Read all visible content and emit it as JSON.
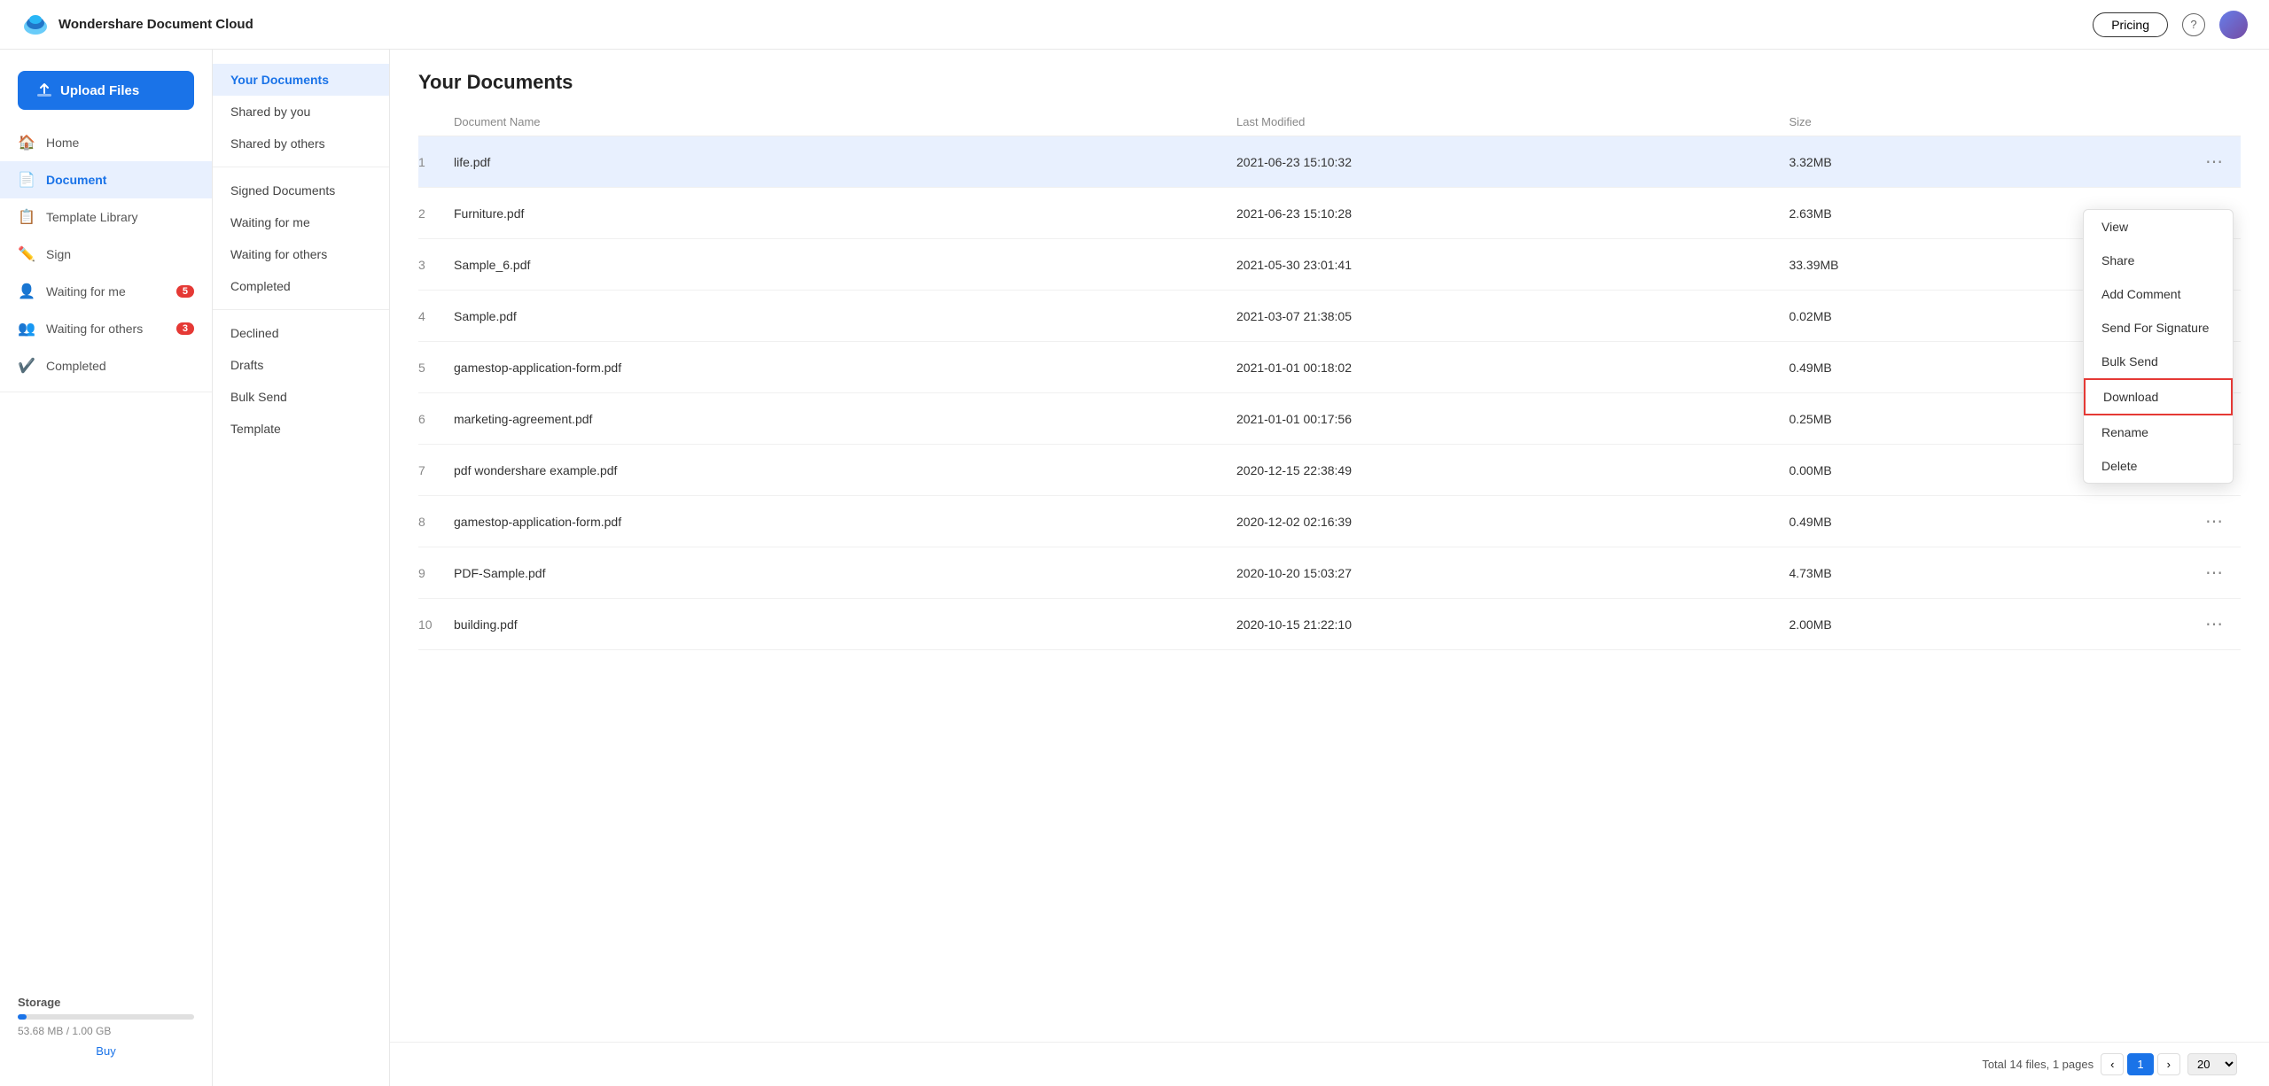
{
  "topbar": {
    "app_title": "Wondershare Document Cloud",
    "pricing_label": "Pricing",
    "help_symbol": "?",
    "logo_colors": [
      "#29b6f6",
      "#1565c0"
    ]
  },
  "sidebar": {
    "upload_label": "Upload Files",
    "nav_items": [
      {
        "id": "home",
        "label": "Home",
        "icon": "home"
      },
      {
        "id": "document",
        "label": "Document",
        "icon": "document",
        "active": true
      },
      {
        "id": "template-library",
        "label": "Template Library",
        "icon": "template"
      },
      {
        "id": "sign",
        "label": "Sign",
        "icon": "sign"
      },
      {
        "id": "waiting-for-me",
        "label": "Waiting for me",
        "icon": "person",
        "badge": "5"
      },
      {
        "id": "waiting-for-others",
        "label": "Waiting for others",
        "icon": "group",
        "badge": "3"
      },
      {
        "id": "completed",
        "label": "Completed",
        "icon": "check"
      }
    ],
    "storage_label": "Storage",
    "storage_used": "53.68 MB / 1.00 GB",
    "storage_percent": 5.3,
    "buy_label": "Buy"
  },
  "center_panel": {
    "nav_items": [
      {
        "id": "your-documents",
        "label": "Your Documents",
        "active": true
      },
      {
        "id": "shared-by-you",
        "label": "Shared by you"
      },
      {
        "id": "shared-by-others",
        "label": "Shared by others"
      },
      {
        "id": "signed-documents",
        "label": "Signed Documents"
      },
      {
        "id": "waiting-for-me",
        "label": "Waiting for me"
      },
      {
        "id": "waiting-for-others",
        "label": "Waiting for others"
      },
      {
        "id": "completed",
        "label": "Completed"
      },
      {
        "id": "declined",
        "label": "Declined"
      },
      {
        "id": "drafts",
        "label": "Drafts"
      },
      {
        "id": "bulk-send",
        "label": "Bulk Send"
      },
      {
        "id": "template",
        "label": "Template"
      }
    ]
  },
  "main": {
    "title": "Your Documents",
    "columns": [
      "",
      "Document Name",
      "Last Modified",
      "Size",
      ""
    ],
    "rows": [
      {
        "num": 1,
        "name": "life.pdf",
        "modified": "2021-06-23 15:10:32",
        "size": "3.32MB",
        "highlighted": true
      },
      {
        "num": 2,
        "name": "Furniture.pdf",
        "modified": "2021-06-23 15:10:28",
        "size": "2.63MB",
        "highlighted": false
      },
      {
        "num": 3,
        "name": "Sample_6.pdf",
        "modified": "2021-05-30 23:01:41",
        "size": "33.39MB",
        "highlighted": false
      },
      {
        "num": 4,
        "name": "Sample.pdf",
        "modified": "2021-03-07 21:38:05",
        "size": "0.02MB",
        "highlighted": false
      },
      {
        "num": 5,
        "name": "gamestop-application-form.pdf",
        "modified": "2021-01-01 00:18:02",
        "size": "0.49MB",
        "highlighted": false
      },
      {
        "num": 6,
        "name": "marketing-agreement.pdf",
        "modified": "2021-01-01 00:17:56",
        "size": "0.25MB",
        "highlighted": false
      },
      {
        "num": 7,
        "name": "pdf wondershare example.pdf",
        "modified": "2020-12-15 22:38:49",
        "size": "0.00MB",
        "highlighted": false
      },
      {
        "num": 8,
        "name": "gamestop-application-form.pdf",
        "modified": "2020-12-02 02:16:39",
        "size": "0.49MB",
        "highlighted": false
      },
      {
        "num": 9,
        "name": "PDF-Sample.pdf",
        "modified": "2020-10-20 15:03:27",
        "size": "4.73MB",
        "highlighted": false
      },
      {
        "num": 10,
        "name": "building.pdf",
        "modified": "2020-10-15 21:22:10",
        "size": "2.00MB",
        "highlighted": false
      }
    ],
    "footer": {
      "total_info": "Total 14 files, 1 pages",
      "current_page": "1",
      "per_page": "20"
    },
    "context_menu": {
      "items": [
        {
          "id": "view",
          "label": "View"
        },
        {
          "id": "share",
          "label": "Share"
        },
        {
          "id": "add-comment",
          "label": "Add Comment"
        },
        {
          "id": "send-for-signature",
          "label": "Send For Signature"
        },
        {
          "id": "bulk-send",
          "label": "Bulk Send"
        },
        {
          "id": "download",
          "label": "Download",
          "highlighted": true
        },
        {
          "id": "rename",
          "label": "Rename"
        },
        {
          "id": "delete",
          "label": "Delete"
        }
      ]
    }
  }
}
